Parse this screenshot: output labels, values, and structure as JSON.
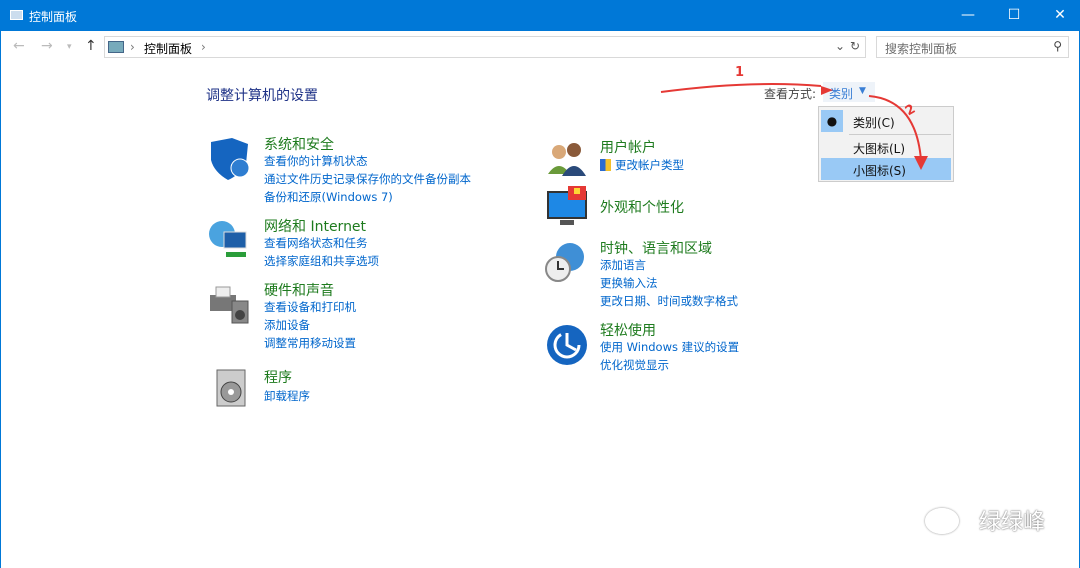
{
  "window": {
    "title": "控制面板",
    "minimize": "—",
    "maximize": "☐",
    "close": "✕"
  },
  "address": {
    "crumb": "控制面板",
    "sep": "›",
    "search_placeholder": "搜索控制面板"
  },
  "heading": "调整计算机的设置",
  "view": {
    "label": "查看方式:",
    "selected": "类别",
    "options": [
      "类别(C)",
      "大图标(L)",
      "小图标(S)"
    ]
  },
  "annotations": {
    "step1": "1",
    "step2": "2"
  },
  "left": [
    {
      "title": "系统和安全",
      "links": [
        "查看你的计算机状态",
        "通过文件历史记录保存你的文件备份副本",
        "备份和还原(Windows 7)"
      ]
    },
    {
      "title": "网络和 Internet",
      "links": [
        "查看网络状态和任务",
        "选择家庭组和共享选项"
      ]
    },
    {
      "title": "硬件和声音",
      "links": [
        "查看设备和打印机",
        "添加设备",
        "调整常用移动设置"
      ]
    },
    {
      "title": "程序",
      "links": [
        "卸载程序"
      ]
    }
  ],
  "right": [
    {
      "title": "用户帐户",
      "links": [
        "更改帐户类型"
      ]
    },
    {
      "title": "外观和个性化",
      "links": []
    },
    {
      "title": "时钟、语言和区域",
      "links": [
        "添加语言",
        "更换输入法",
        "更改日期、时间或数字格式"
      ]
    },
    {
      "title": "轻松使用",
      "links": [
        "使用 Windows 建议的设置",
        "优化视觉显示"
      ]
    }
  ],
  "watermark": "绿绿峰"
}
